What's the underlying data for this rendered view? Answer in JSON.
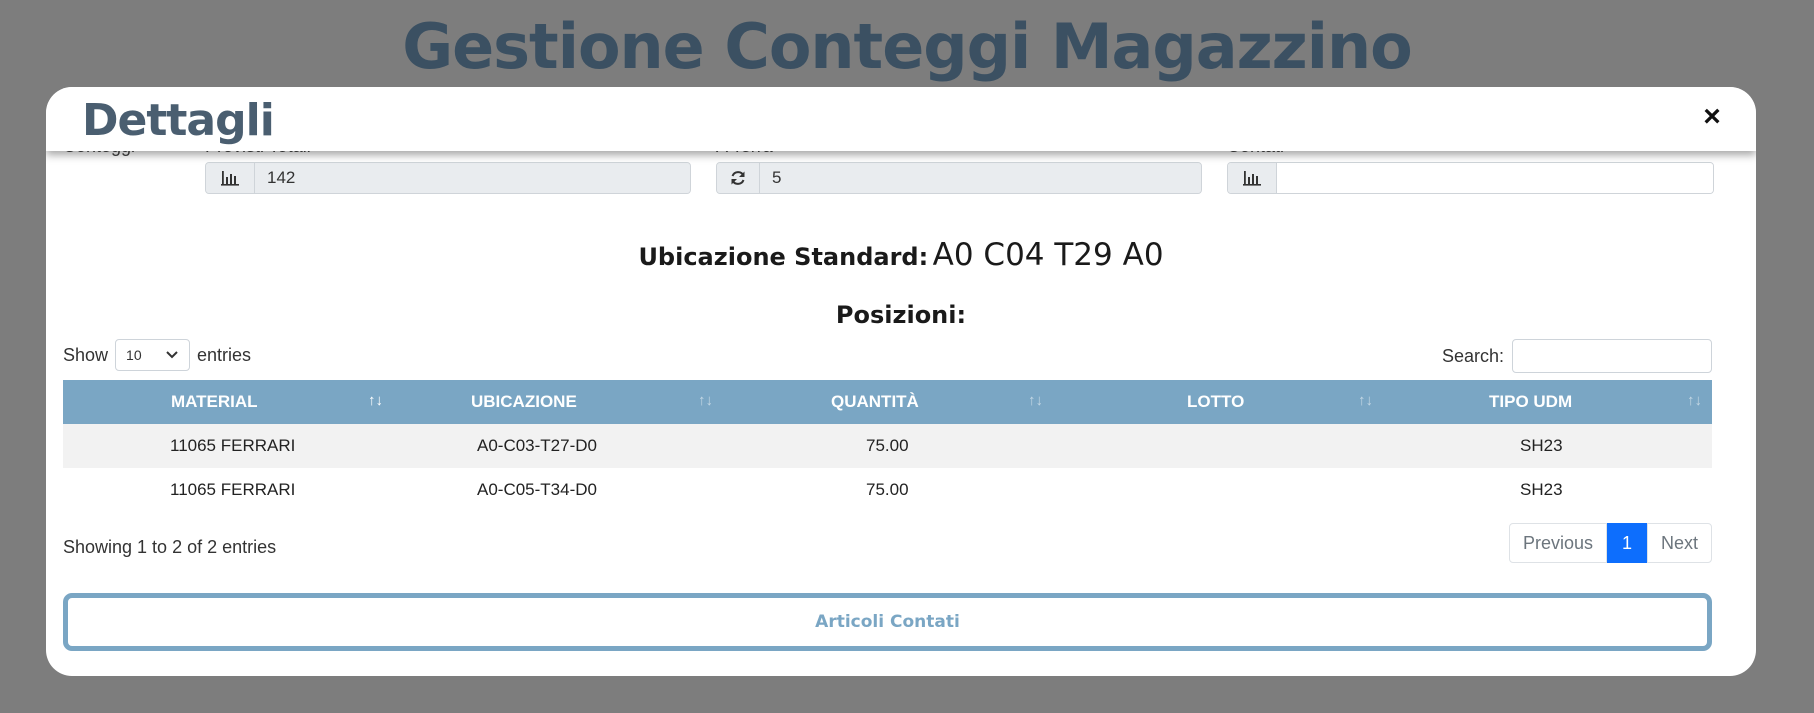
{
  "page": {
    "title": "Gestione Conteggi Magazzino"
  },
  "modal": {
    "title": "Dettagli",
    "close_label": "×",
    "conteggi_label": "Conteggi",
    "previsti": {
      "label": "Previsti Totali",
      "value": "142",
      "icon": "bar-chart-icon"
    },
    "a_terra": {
      "label": "A Terra",
      "value": "5",
      "icon": "refresh-icon"
    },
    "contati": {
      "label": "Contati",
      "value": "",
      "icon": "bar-chart-icon"
    },
    "ubicazione_label": "Ubicazione Standard:",
    "ubicazione_value": "A0 C04 T29 A0",
    "posizioni_label": "Posizioni:",
    "table_controls": {
      "show_label": "Show",
      "entries_value": "10",
      "entries_label": "entries",
      "search_label": "Search:"
    },
    "table": {
      "columns": [
        "MATERIAL",
        "UBICAZIONE",
        "QUANTITÀ",
        "LOTTO",
        "TIPO UDM"
      ],
      "rows": [
        [
          "11065 FERRARI",
          "A0-C03-T27-D0",
          "75.00",
          "",
          "SH23"
        ],
        [
          "11065 FERRARI",
          "A0-C05-T34-D0",
          "75.00",
          "",
          "SH23"
        ]
      ]
    },
    "info_text": "Showing 1 to 2 of 2 entries",
    "pagination": {
      "previous": "Previous",
      "current": "1",
      "next": "Next"
    },
    "articoli_button": "Articoli Contati"
  },
  "colors": {
    "accent": "#7aa6c4",
    "title": "#3b5062",
    "page_active": "#0d6efd",
    "overlay": "#7d7d7d"
  }
}
